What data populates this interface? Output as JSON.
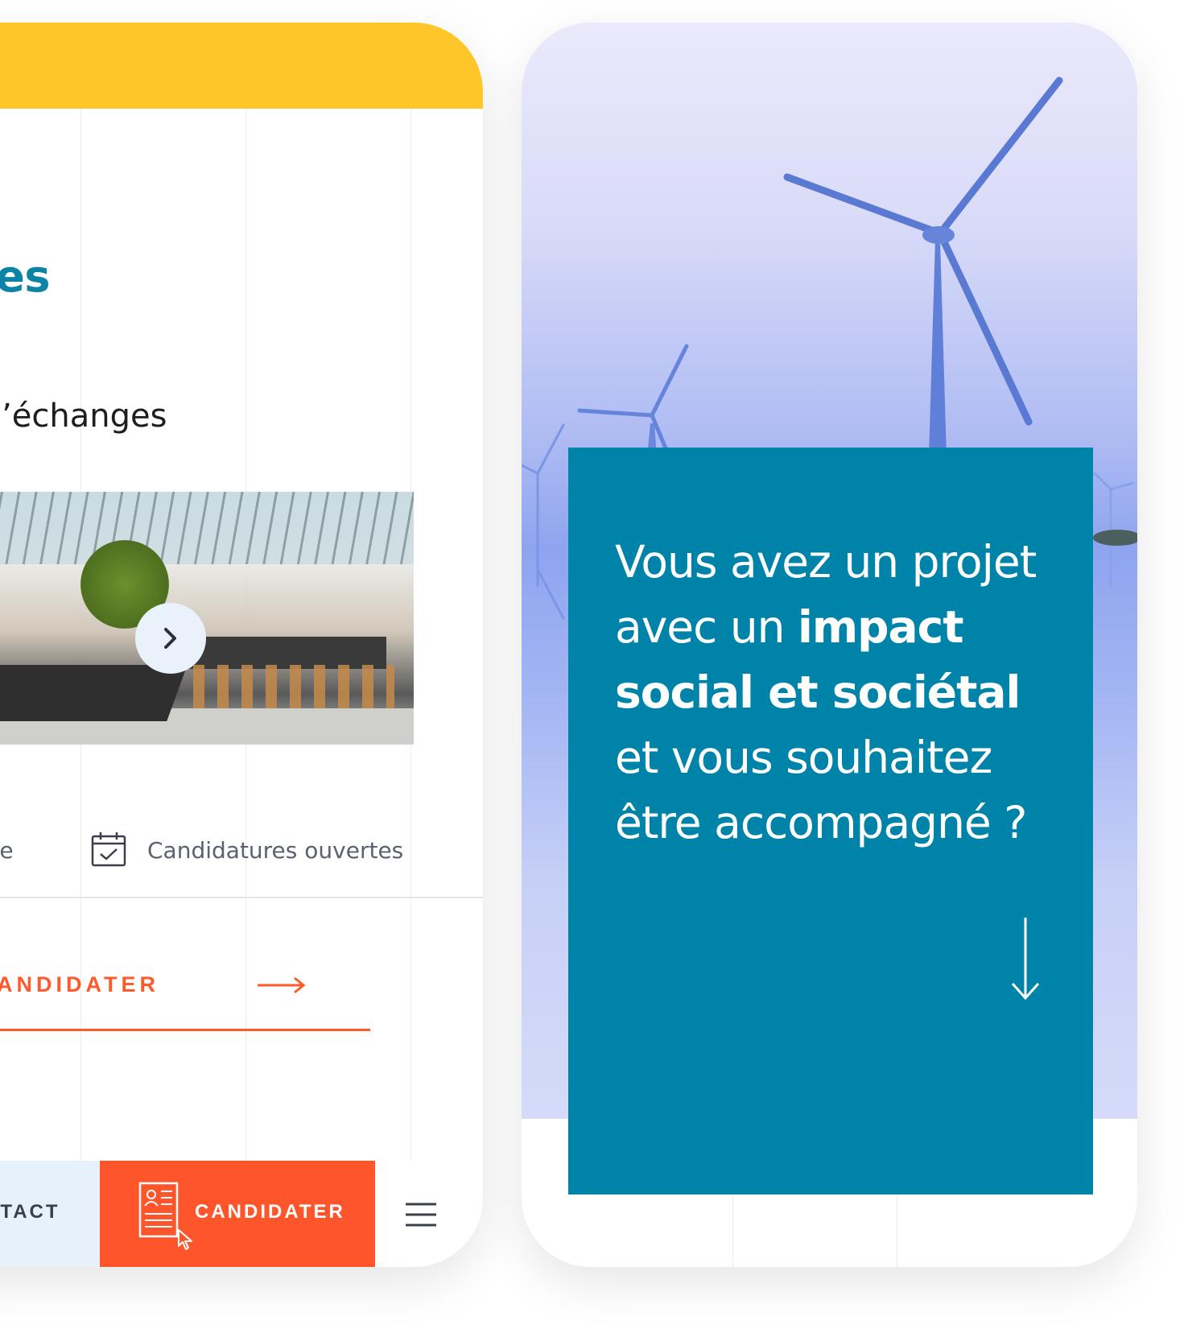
{
  "left_phone": {
    "heading_fragment": "vices",
    "subheading_fragment": "eu d’échanges",
    "meta": {
      "cut_label": "ille",
      "status_label": "Candidatures ouvertes"
    },
    "cta_link_label": "ANDIDATER",
    "bottom_bar": {
      "contact_label": "NTACT",
      "candidater_label": "CANDIDATER"
    },
    "colors": {
      "top_bar": "#ffc629",
      "heading": "#0b84a5",
      "accent": "#ff552b"
    },
    "icons": [
      "chevron-right-icon",
      "calendar-check-icon",
      "arrow-right-icon",
      "document-icon",
      "cursor-icon",
      "hamburger-menu-icon"
    ]
  },
  "right_phone": {
    "card": {
      "line1": "Vous avez un projet",
      "line2_normal": "avec un ",
      "line2_bold": "impact",
      "line3_bold": "social et sociétal",
      "line4": "et vous souhaitez",
      "line5": "être accompagné ?"
    },
    "colors": {
      "card": "#0083a8"
    },
    "icons": [
      "wind-turbine-icon",
      "arrow-down-icon"
    ]
  }
}
